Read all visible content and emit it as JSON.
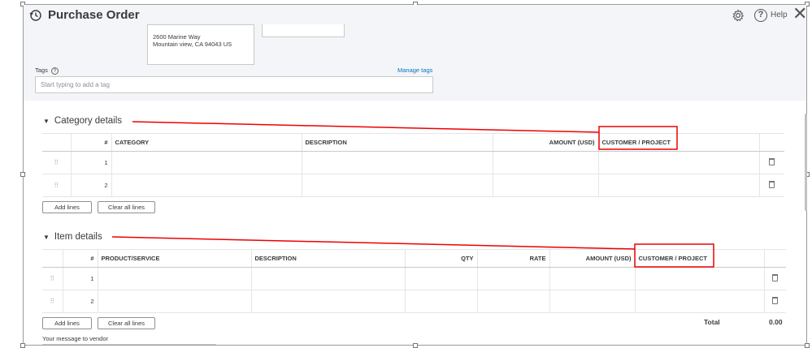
{
  "header": {
    "title": "Purchase Order",
    "help_label": "Help"
  },
  "address": {
    "line1": "2600 Marine Way",
    "line2": "Mountain view, CA  94043 US"
  },
  "tags": {
    "label": "Tags",
    "help_glyph": "?",
    "manage_label": "Manage tags",
    "placeholder": "Start typing to add a tag"
  },
  "category_details": {
    "title": "Category details",
    "columns": {
      "num": "#",
      "category": "CATEGORY",
      "description": "DESCRIPTION",
      "amount": "AMOUNT (USD)",
      "customer": "CUSTOMER / PROJECT"
    },
    "rows": [
      "1",
      "2"
    ],
    "add_lines": "Add lines",
    "clear_lines": "Clear all lines"
  },
  "item_details": {
    "title": "Item details",
    "columns": {
      "num": "#",
      "product": "PRODUCT/SERVICE",
      "description": "DESCRIPTION",
      "qty": "QTY",
      "rate": "RATE",
      "amount": "AMOUNT (USD)",
      "customer": "CUSTOMER / PROJECT"
    },
    "rows": [
      "1",
      "2"
    ],
    "add_lines": "Add lines",
    "clear_lines": "Clear all lines"
  },
  "totals": {
    "label": "Total",
    "value": "0.00"
  },
  "message": {
    "label": "Your message to vendor"
  },
  "colors": {
    "accent": "#0077c5",
    "highlight": "#ee0000",
    "header_bg": "#f4f5f8"
  },
  "icons": [
    "history-icon",
    "gear-icon",
    "help-icon",
    "close-icon",
    "drag-handle-icon",
    "trash-icon",
    "collapse-triangle-icon"
  ]
}
